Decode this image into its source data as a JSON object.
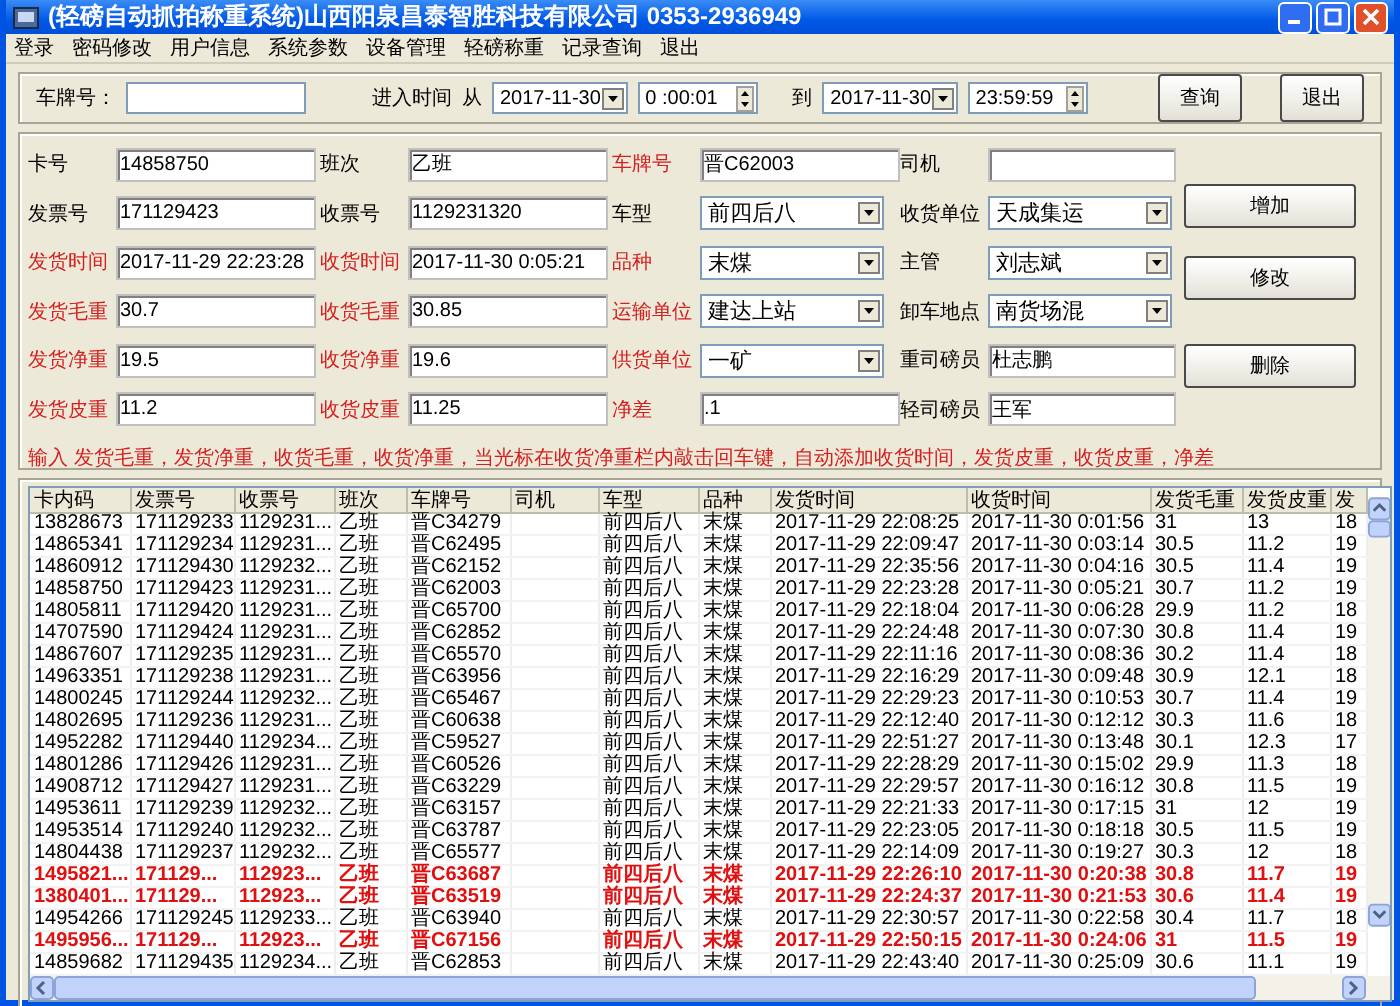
{
  "window": {
    "title": "(轻磅自动抓拍称重系统)山西阳泉昌泰智胜科技有限公司  0353-2936949"
  },
  "menu": [
    "登录",
    "密码修改",
    "用户信息",
    "系统参数",
    "设备管理",
    "轻磅称重",
    "记录查询",
    "退出"
  ],
  "filter": {
    "plate_label": "车牌号：",
    "time_label": "进入时间",
    "from_label": "从",
    "from_date": "2017-11-30",
    "from_time": "0 :00:01",
    "to_label": "到",
    "to_date": "2017-11-30",
    "to_time": "23:59:59",
    "buttons": [
      "查询",
      "退出"
    ]
  },
  "form": {
    "columns": [
      [
        {
          "label": "卡号",
          "emphasized": false,
          "kind": "input",
          "value": "14858750"
        },
        {
          "label": "发票号",
          "emphasized": false,
          "kind": "input",
          "value": "171129423"
        },
        {
          "label": "发货时间",
          "emphasized": true,
          "kind": "input",
          "value": "2017-11-29 22:23:28"
        },
        {
          "label": "发货毛重",
          "emphasized": true,
          "kind": "input",
          "value": "30.7"
        },
        {
          "label": "发货净重",
          "emphasized": true,
          "kind": "input",
          "value": "19.5"
        },
        {
          "label": "发货皮重",
          "emphasized": true,
          "kind": "input",
          "value": "11.2"
        }
      ],
      [
        {
          "label": "班次",
          "emphasized": false,
          "kind": "input",
          "value": "乙班"
        },
        {
          "label": "收票号",
          "emphasized": false,
          "kind": "input",
          "value": "1129231320"
        },
        {
          "label": "收货时间",
          "emphasized": true,
          "kind": "input",
          "value": "2017-11-30 0:05:21"
        },
        {
          "label": "收货毛重",
          "emphasized": true,
          "kind": "input",
          "value": "30.85"
        },
        {
          "label": "收货净重",
          "emphasized": true,
          "kind": "input",
          "value": "19.6"
        },
        {
          "label": "收货皮重",
          "emphasized": true,
          "kind": "input",
          "value": "11.25"
        }
      ],
      [
        {
          "label": "车牌号",
          "emphasized": true,
          "kind": "input",
          "value": "晋C62003"
        },
        {
          "label": "车型",
          "emphasized": false,
          "kind": "select",
          "value": "前四后八"
        },
        {
          "label": "品种",
          "emphasized": true,
          "kind": "select",
          "value": "末煤"
        },
        {
          "label": "运输单位",
          "emphasized": true,
          "kind": "select",
          "value": "建达上站"
        },
        {
          "label": "供货单位",
          "emphasized": true,
          "kind": "select",
          "value": "一矿"
        },
        {
          "label": "净差",
          "emphasized": true,
          "kind": "input",
          "value": ".1"
        }
      ],
      [
        {
          "label": "司机",
          "emphasized": false,
          "kind": "input"
        },
        {
          "label": "收货单位",
          "emphasized": false,
          "kind": "select",
          "value": "天成集运"
        },
        {
          "label": "主管",
          "emphasized": false,
          "kind": "select",
          "value": "刘志斌"
        },
        {
          "label": "卸车地点",
          "emphasized": false,
          "kind": "select",
          "value": "南货场混"
        },
        {
          "label": "重司磅员",
          "emphasized": false,
          "kind": "input",
          "value": "杜志鹏"
        },
        {
          "label": "轻司磅员",
          "emphasized": false,
          "kind": "input",
          "value": "王军"
        }
      ]
    ],
    "buttons": [
      "增加",
      "修改",
      "删除"
    ],
    "hint": "输入 发货毛重，发货净重，收货毛重，收货净重，当光标在收货净重栏内敲击回车键，自动添加收货时间，发货皮重，收货皮重，净差"
  },
  "table": {
    "columns": [
      "卡内码",
      "发票号",
      "收票号",
      "班次",
      "车牌号",
      "司机",
      "车型",
      "品种",
      "发货时间",
      "收货时间",
      "发货毛重",
      "发货皮重",
      "发"
    ],
    "rows": [
      {
        "highlighted": false,
        "cells": [
          "13828673",
          "171129233",
          "1129231...",
          "乙班",
          "晋C34279",
          "",
          "前四后八",
          "末煤",
          "2017-11-29 22:08:25",
          "2017-11-30 0:01:56",
          "31",
          "13",
          "18"
        ]
      },
      {
        "highlighted": false,
        "cells": [
          "14865341",
          "171129234",
          "1129231...",
          "乙班",
          "晋C62495",
          "",
          "前四后八",
          "末煤",
          "2017-11-29 22:09:47",
          "2017-11-30 0:03:14",
          "30.5",
          "11.2",
          "19"
        ]
      },
      {
        "highlighted": false,
        "cells": [
          "14860912",
          "171129430",
          "1129232...",
          "乙班",
          "晋C62152",
          "",
          "前四后八",
          "末煤",
          "2017-11-29 22:35:56",
          "2017-11-30 0:04:16",
          "30.5",
          "11.4",
          "19"
        ]
      },
      {
        "highlighted": false,
        "cells": [
          "14858750",
          "171129423",
          "1129231...",
          "乙班",
          "晋C62003",
          "",
          "前四后八",
          "末煤",
          "2017-11-29 22:23:28",
          "2017-11-30 0:05:21",
          "30.7",
          "11.2",
          "19"
        ]
      },
      {
        "highlighted": false,
        "cells": [
          "14805811",
          "171129420",
          "1129231...",
          "乙班",
          "晋C65700",
          "",
          "前四后八",
          "末煤",
          "2017-11-29 22:18:04",
          "2017-11-30 0:06:28",
          "29.9",
          "11.2",
          "18"
        ]
      },
      {
        "highlighted": false,
        "cells": [
          "14707590",
          "171129424",
          "1129231...",
          "乙班",
          "晋C62852",
          "",
          "前四后八",
          "末煤",
          "2017-11-29 22:24:48",
          "2017-11-30 0:07:30",
          "30.8",
          "11.4",
          "19"
        ]
      },
      {
        "highlighted": false,
        "cells": [
          "14867607",
          "171129235",
          "1129231...",
          "乙班",
          "晋C65570",
          "",
          "前四后八",
          "末煤",
          "2017-11-29 22:11:16",
          "2017-11-30 0:08:36",
          "30.2",
          "11.4",
          "18"
        ]
      },
      {
        "highlighted": false,
        "cells": [
          "14963351",
          "171129238",
          "1129231...",
          "乙班",
          "晋C63956",
          "",
          "前四后八",
          "末煤",
          "2017-11-29 22:16:29",
          "2017-11-30 0:09:48",
          "30.9",
          "12.1",
          "18"
        ]
      },
      {
        "highlighted": false,
        "cells": [
          "14800245",
          "171129244",
          "1129232...",
          "乙班",
          "晋C65467",
          "",
          "前四后八",
          "末煤",
          "2017-11-29 22:29:23",
          "2017-11-30 0:10:53",
          "30.7",
          "11.4",
          "19"
        ]
      },
      {
        "highlighted": false,
        "cells": [
          "14802695",
          "171129236",
          "1129231...",
          "乙班",
          "晋C60638",
          "",
          "前四后八",
          "末煤",
          "2017-11-29 22:12:40",
          "2017-11-30 0:12:12",
          "30.3",
          "11.6",
          "18"
        ]
      },
      {
        "highlighted": false,
        "cells": [
          "14952282",
          "171129440",
          "1129234...",
          "乙班",
          "晋C59527",
          "",
          "前四后八",
          "末煤",
          "2017-11-29 22:51:27",
          "2017-11-30 0:13:48",
          "30.1",
          "12.3",
          "17"
        ]
      },
      {
        "highlighted": false,
        "cells": [
          "14801286",
          "171129426",
          "1129231...",
          "乙班",
          "晋C60526",
          "",
          "前四后八",
          "末煤",
          "2017-11-29 22:28:29",
          "2017-11-30 0:15:02",
          "29.9",
          "11.3",
          "18"
        ]
      },
      {
        "highlighted": false,
        "cells": [
          "14908712",
          "171129427",
          "1129231...",
          "乙班",
          "晋C63229",
          "",
          "前四后八",
          "末煤",
          "2017-11-29 22:29:57",
          "2017-11-30 0:16:12",
          "30.8",
          "11.5",
          "19"
        ]
      },
      {
        "highlighted": false,
        "cells": [
          "14953611",
          "171129239",
          "1129232...",
          "乙班",
          "晋C63157",
          "",
          "前四后八",
          "末煤",
          "2017-11-29 22:21:33",
          "2017-11-30 0:17:15",
          "31",
          "12",
          "19"
        ]
      },
      {
        "highlighted": false,
        "cells": [
          "14953514",
          "171129240",
          "1129232...",
          "乙班",
          "晋C63787",
          "",
          "前四后八",
          "末煤",
          "2017-11-29 22:23:05",
          "2017-11-30 0:18:18",
          "30.5",
          "11.5",
          "19"
        ]
      },
      {
        "highlighted": false,
        "cells": [
          "14804438",
          "171129237",
          "1129232...",
          "乙班",
          "晋C65577",
          "",
          "前四后八",
          "末煤",
          "2017-11-29 22:14:09",
          "2017-11-30 0:19:27",
          "30.3",
          "12",
          "18"
        ]
      },
      {
        "highlighted": true,
        "cells": [
          "1495821...",
          "171129...",
          "112923...",
          "乙班",
          "晋C63687",
          "",
          "前四后八",
          "末煤",
          "2017-11-29 22:26:10",
          "2017-11-30 0:20:38",
          "30.8",
          "11.7",
          "19"
        ]
      },
      {
        "highlighted": true,
        "cells": [
          "1380401...",
          "171129...",
          "112923...",
          "乙班",
          "晋C63519",
          "",
          "前四后八",
          "末煤",
          "2017-11-29 22:24:37",
          "2017-11-30 0:21:53",
          "30.6",
          "11.4",
          "19"
        ]
      },
      {
        "highlighted": false,
        "cells": [
          "14954266",
          "171129245",
          "1129233...",
          "乙班",
          "晋C63940",
          "",
          "前四后八",
          "末煤",
          "2017-11-29 22:30:57",
          "2017-11-30 0:22:58",
          "30.4",
          "11.7",
          "18"
        ]
      },
      {
        "highlighted": true,
        "cells": [
          "1495956...",
          "171129...",
          "112923...",
          "乙班",
          "晋C67156",
          "",
          "前四后八",
          "末煤",
          "2017-11-29 22:50:15",
          "2017-11-30 0:24:06",
          "31",
          "11.5",
          "19"
        ]
      },
      {
        "highlighted": false,
        "cells": [
          "14859682",
          "171129435",
          "1129234...",
          "乙班",
          "晋C62853",
          "",
          "前四后八",
          "末煤",
          "2017-11-29 22:43:40",
          "2017-11-30 0:25:09",
          "30.6",
          "11.1",
          "19"
        ]
      }
    ]
  }
}
